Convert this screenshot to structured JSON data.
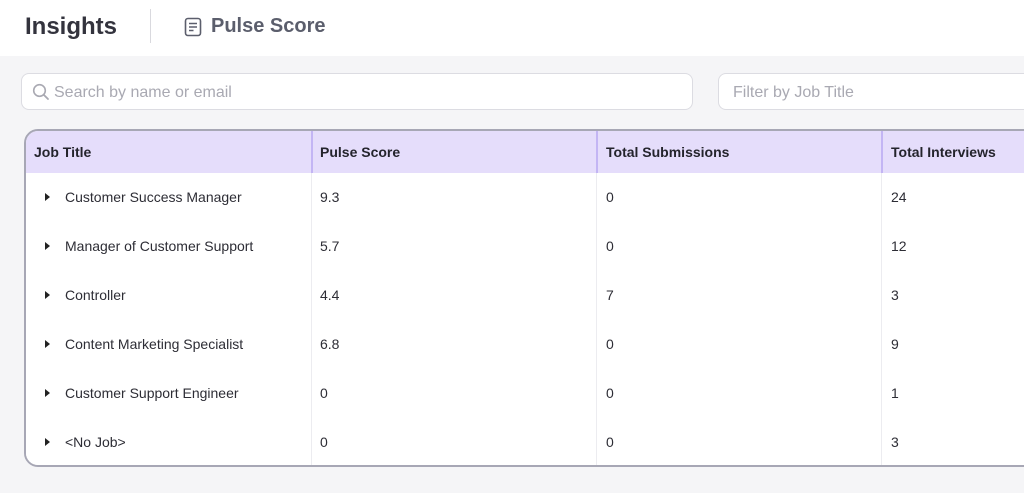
{
  "header": {
    "app_title": "Insights",
    "page_title": "Pulse Score",
    "page_icon": "document-list-icon"
  },
  "filters": {
    "search_placeholder": "Search by name or email",
    "search_value": "",
    "job_title_placeholder": "Filter by Job Title",
    "job_title_value": ""
  },
  "table": {
    "columns": [
      "Job Title",
      "Pulse Score",
      "Total Submissions",
      "Total Interviews"
    ],
    "rows": [
      {
        "job_title": "Customer Success Manager",
        "pulse_score": "9.3",
        "total_submissions": "0",
        "total_interviews": "24"
      },
      {
        "job_title": "Manager of Customer Support",
        "pulse_score": "5.7",
        "total_submissions": "0",
        "total_interviews": "12"
      },
      {
        "job_title": "Controller",
        "pulse_score": "4.4",
        "total_submissions": "7",
        "total_interviews": "3"
      },
      {
        "job_title": "Content Marketing Specialist",
        "pulse_score": "6.8",
        "total_submissions": "0",
        "total_interviews": "9"
      },
      {
        "job_title": "Customer Support Engineer",
        "pulse_score": "0",
        "total_submissions": "0",
        "total_interviews": "1"
      },
      {
        "job_title": "<No Job>",
        "pulse_score": "0",
        "total_submissions": "0",
        "total_interviews": "3"
      }
    ]
  },
  "colors": {
    "header_bg": "#e5ddfb",
    "header_separator": "#c3b5f4",
    "table_border": "#a7a7b5",
    "page_bg": "#f5f5f7"
  }
}
